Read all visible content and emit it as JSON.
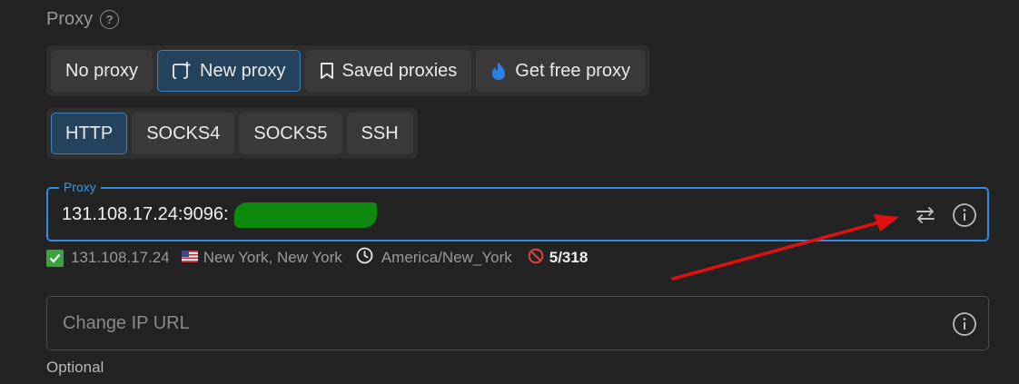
{
  "section": {
    "title": "Proxy"
  },
  "mode_tabs": [
    {
      "label": "No proxy",
      "icon": "none",
      "active": false
    },
    {
      "label": "New proxy",
      "icon": "new-proxy-icon",
      "active": true
    },
    {
      "label": "Saved proxies",
      "icon": "bookmark-icon",
      "active": false
    },
    {
      "label": "Get free proxy",
      "icon": "flame-icon",
      "active": false
    }
  ],
  "type_tabs": [
    {
      "label": "HTTP",
      "active": true
    },
    {
      "label": "SOCKS4",
      "active": false
    },
    {
      "label": "SOCKS5",
      "active": false
    },
    {
      "label": "SSH",
      "active": false
    }
  ],
  "proxy_input": {
    "label": "Proxy",
    "value": "131.108.17.24:9096:",
    "redacted": true
  },
  "status": {
    "ip": "131.108.17.24",
    "location": "New York, New York",
    "timezone": "America/New_York",
    "count": "5/318"
  },
  "change_ip": {
    "placeholder": "Change IP URL",
    "helper": "Optional"
  },
  "colors": {
    "accent": "#2f8ae0",
    "active_tab": "#26435d",
    "success": "#3aa33e",
    "annotation_arrow": "#e01010",
    "redaction": "#0d8a0d"
  }
}
